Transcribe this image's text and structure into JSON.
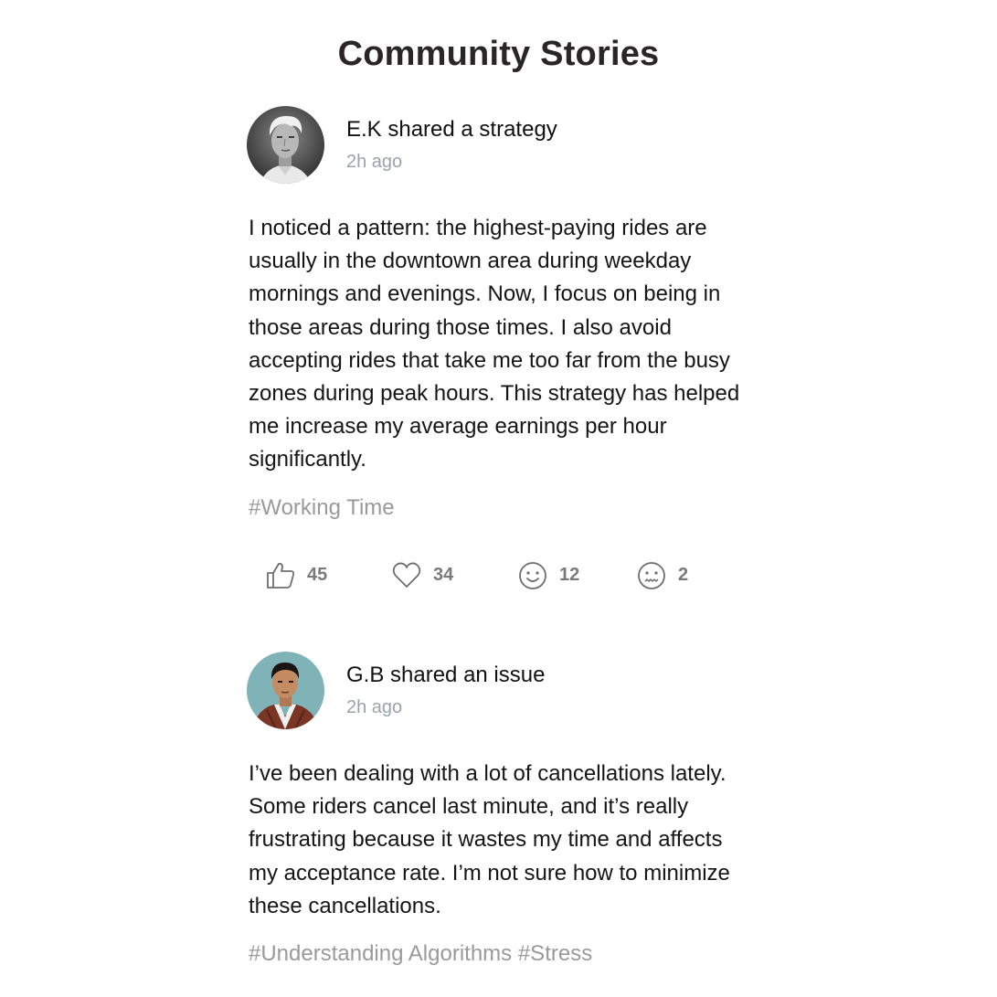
{
  "page": {
    "title": "Community Stories"
  },
  "posts": [
    {
      "author_line": "E.K shared a strategy",
      "timestamp": "2h ago",
      "avatar_icon": "avatar-older-man",
      "body": "I noticed a pattern: the highest-paying rides are usually in the downtown area during weekday mornings and evenings. Now, I focus on being in those areas during those times. I also avoid accepting rides that take me too far from the busy zones during peak hours. This strategy has helped me increase my average earnings per hour significantly.",
      "tags": "#Working Time",
      "reactions": [
        {
          "icon": "thumbs-up-icon",
          "count": "45"
        },
        {
          "icon": "heart-icon",
          "count": "34"
        },
        {
          "icon": "smile-icon",
          "count": "12"
        },
        {
          "icon": "sad-face-icon",
          "count": "2"
        }
      ]
    },
    {
      "author_line": "G.B shared an issue",
      "timestamp": "2h ago",
      "avatar_icon": "avatar-young-man",
      "body": "I’ve been dealing with a lot of cancellations lately. Some riders cancel last minute, and it’s really frustrating because it wastes my time and affects my acceptance rate. I’m not sure how to minimize these cancellations.",
      "tags": "#Understanding Algorithms #Stress"
    }
  ],
  "colors": {
    "title": "#2a2526",
    "timestamp": "#9aa3ad",
    "tags": "#9a9a9a",
    "reaction_count": "#7a7a7a",
    "icon_stroke": "#6e6e6e",
    "avatar2_bg": "#7fb3b8"
  }
}
